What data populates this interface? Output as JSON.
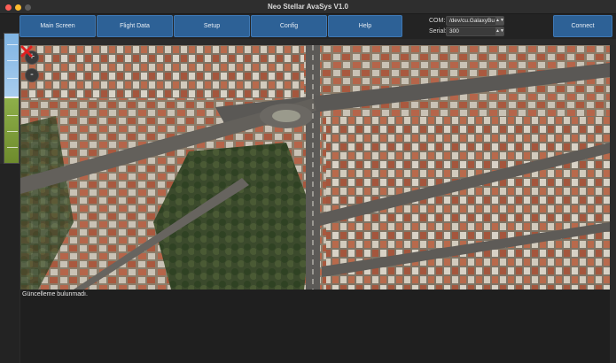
{
  "window": {
    "title": "Neo Stellar AvaSys V1.0"
  },
  "toolbar": {
    "main_screen": "Main Screen",
    "flight_data": "Flight Data",
    "setup": "Setup",
    "config": "Config",
    "help": "Help",
    "connect": "Connect"
  },
  "connection": {
    "com_label": "COM:",
    "com_value": "/dev/cu.GalaxyBu",
    "serial_label": "Serial:",
    "serial_value": "300"
  },
  "map": {
    "zoom_in": "+",
    "zoom_out": "-"
  },
  "log": {
    "message": "Güncelleme bulunmadı."
  },
  "colors": {
    "button": "#2d6196",
    "marker": "#e02020",
    "sky": "#8fbfe8",
    "ground": "#7d9c3a"
  }
}
